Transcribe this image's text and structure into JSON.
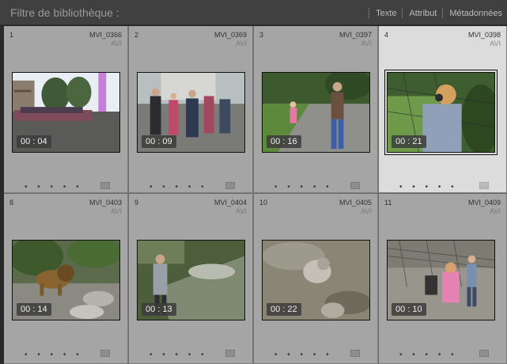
{
  "filter_bar": {
    "title": "Filtre de bibliothèque :",
    "tabs": [
      "Texte",
      "Attribut",
      "Métadonnées"
    ]
  },
  "cells": [
    {
      "index": "1",
      "filename": "MVI_0366",
      "ext": "AVI",
      "duration": "00 : 04",
      "selected": false,
      "scene": "school-building-crowd"
    },
    {
      "index": "2",
      "filename": "MVI_0369",
      "ext": "AVI",
      "duration": "00 : 09",
      "selected": false,
      "scene": "children-group-street"
    },
    {
      "index": "3",
      "filename": "MVI_0397",
      "ext": "AVI",
      "duration": "00 : 16",
      "selected": false,
      "scene": "park-path-woman-child"
    },
    {
      "index": "4",
      "filename": "MVI_0398",
      "ext": "AVI",
      "duration": "00 : 21",
      "selected": true,
      "scene": "girl-at-fence"
    },
    {
      "index": "8",
      "filename": "MVI_0403",
      "ext": "AVI",
      "duration": "00 : 14",
      "selected": false,
      "scene": "lion-enclosure"
    },
    {
      "index": "9",
      "filename": "MVI_0404",
      "ext": "AVI",
      "duration": "00 : 13",
      "selected": false,
      "scene": "man-at-zoo-glass"
    },
    {
      "index": "10",
      "filename": "MVI_0405",
      "ext": "AVI",
      "duration": "00 : 22",
      "selected": false,
      "scene": "animal-on-rocks"
    },
    {
      "index": "11",
      "filename": "MVI_0409",
      "ext": "AVI",
      "duration": "00 : 10",
      "selected": false,
      "scene": "children-at-fence"
    }
  ],
  "footer_dots": "• • • • •"
}
